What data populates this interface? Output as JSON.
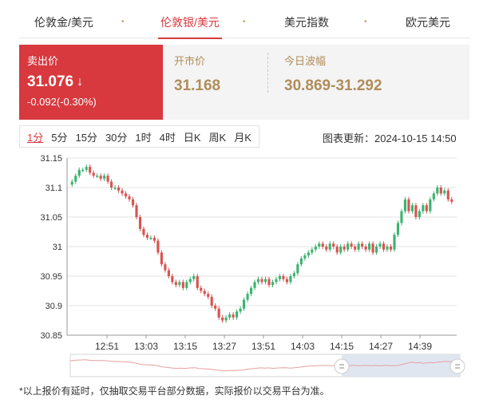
{
  "tabs": [
    {
      "label": "伦敦金/美元",
      "active": false
    },
    {
      "label": "伦敦银/美元",
      "active": true
    },
    {
      "label": "美元指数",
      "active": false
    },
    {
      "label": "欧元美元",
      "active": false
    }
  ],
  "quote": {
    "sell_label": "卖出价",
    "sell_price": "31.076",
    "sell_change": "-0.092(-0.30%)",
    "open_label": "开市价",
    "open_value": "31.168",
    "range_label": "今日波幅",
    "range_value": "30.869-31.292"
  },
  "periods": [
    "1分",
    "5分",
    "15分",
    "30分",
    "1时",
    "4时",
    "日K",
    "周K",
    "月K"
  ],
  "active_period": "1分",
  "update": "图表更新：2024-10-15 14:50",
  "footnote": "*以上报价有延时，仅抽取交易平台部分数据，实际报价以交易平台为准。",
  "colors": {
    "accent": "#d7393e",
    "up": "#3cb371",
    "down": "#d9534f",
    "gold": "#b08d5a"
  },
  "chart_data": {
    "type": "candlestick",
    "title": "",
    "xlabel": "",
    "ylabel": "",
    "ylim": [
      30.85,
      31.15
    ],
    "yticks": [
      "31.15",
      "31.1",
      "31.05",
      "31",
      "30.95",
      "30.9",
      "30.85"
    ],
    "xticks": [
      "12:51",
      "13:03",
      "13:15",
      "13:27",
      "13:51",
      "14:03",
      "14:15",
      "14:27",
      "14:39"
    ],
    "grid": true,
    "close": [
      31.11,
      31.12,
      31.13,
      31.13,
      31.135,
      31.125,
      31.12,
      31.12,
      31.115,
      31.12,
      31.11,
      31.1,
      31.1,
      31.095,
      31.09,
      31.085,
      31.08,
      31.07,
      31.05,
      31.03,
      31.02,
      31.015,
      31.015,
      31.01,
      30.99,
      30.97,
      30.96,
      30.95,
      30.94,
      30.935,
      30.94,
      30.93,
      30.94,
      30.945,
      30.95,
      30.93,
      30.925,
      30.92,
      30.915,
      30.9,
      30.895,
      30.88,
      30.875,
      30.88,
      30.885,
      30.88,
      30.89,
      30.895,
      30.91,
      30.92,
      30.93,
      30.94,
      30.945,
      30.94,
      30.945,
      30.935,
      30.94,
      30.945,
      30.95,
      30.945,
      30.94,
      30.95,
      30.955,
      30.97,
      30.98,
      30.985,
      30.99,
      30.995,
      31.0,
      31.005,
      31.0,
      30.995,
      31.005,
      31.0,
      30.99,
      31.0,
      30.995,
      31.005,
      31.0,
      30.995,
      31.005,
      31.0,
      30.995,
      31.005,
      30.99,
      31.0,
      31.005,
      30.995,
      31.0,
      30.995,
      31.02,
      31.04,
      31.06,
      31.08,
      31.06,
      31.07,
      31.05,
      31.06,
      31.07,
      31.06,
      31.08,
      31.09,
      31.1,
      31.09,
      31.095,
      31.08,
      31.076
    ]
  }
}
